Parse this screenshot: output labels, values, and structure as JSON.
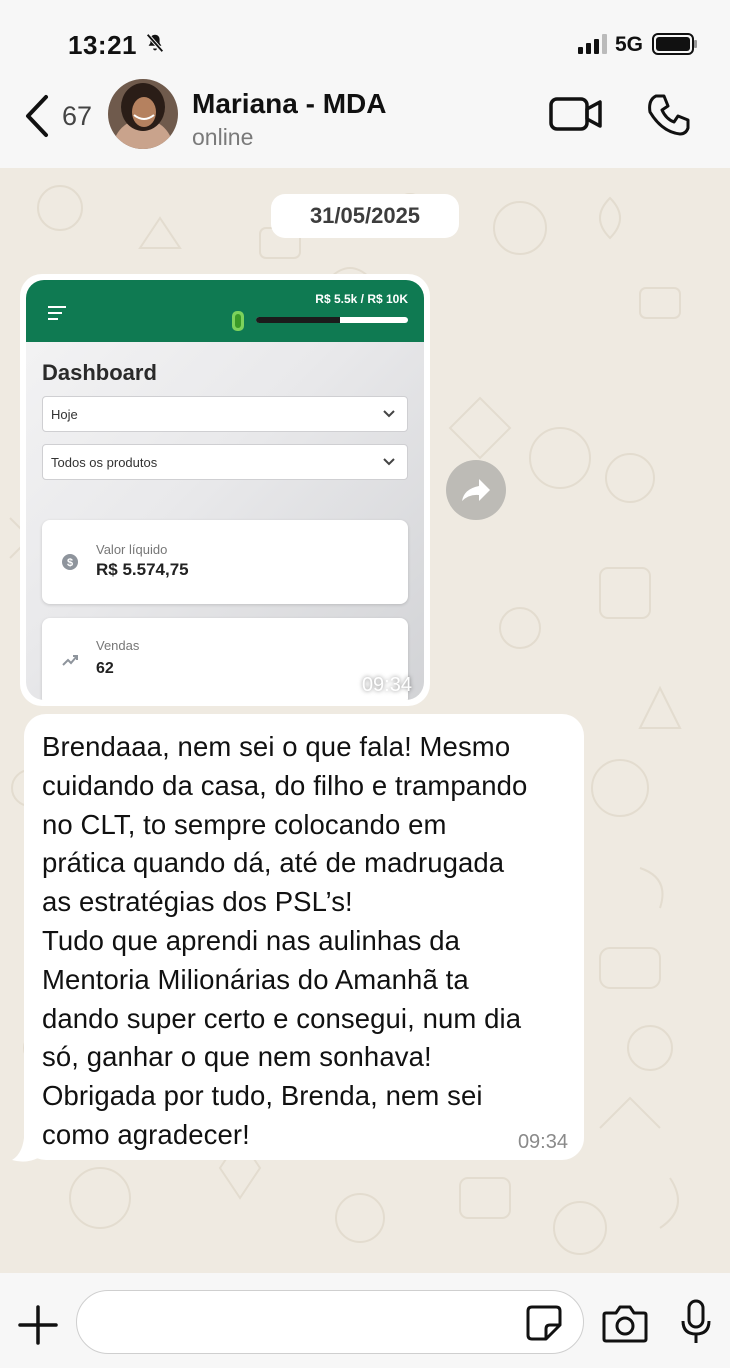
{
  "status_bar": {
    "time": "13:21",
    "network": "5G",
    "icons": [
      "bell-off-icon",
      "signal-icon",
      "battery-icon"
    ]
  },
  "header": {
    "back_count": "67",
    "contact_name": "Mariana - MDA",
    "contact_status": "online",
    "icons": [
      "back-chevron-icon",
      "avatar",
      "video-call-icon",
      "phone-icon"
    ]
  },
  "chat": {
    "date": "31/05/2025",
    "image_message": {
      "time": "09:34",
      "screenshot": {
        "goal_text": "R$ 5.5k   / R$ 10K",
        "goal_progress": 0.55,
        "title": "Dashboard",
        "period_select": "Hoje",
        "product_select": "Todos os produtos",
        "net_value_label": "Valor líquido",
        "net_value": "R$ 5.574,75",
        "sales_label": "Vendas",
        "sales_value": "62"
      }
    },
    "text_message": {
      "text": "Brendaaa, nem sei o que fala! Mesmo\ncuidando da casa, do filho e trampando\nno CLT, to sempre colocando em\nprática quando dá, até de madrugada\nas estratégias dos PSL’s!\nTudo que aprendi nas aulinhas da\nMentoria Milionárias do Amanhã ta\ndando super certo e consegui, num dia\nsó, ganhar o que nem sonhava!\nObrigada por tudo, Brenda, nem sei\ncomo agradecer!",
      "time": "09:34"
    }
  },
  "input_bar": {
    "message_placeholder": "",
    "icons": [
      "plus-icon",
      "sticker-icon",
      "camera-icon",
      "microphone-icon"
    ]
  },
  "colors": {
    "accent_green": "#0f7a52",
    "chat_background": "#efeae1",
    "bubble": "#ffffff"
  }
}
